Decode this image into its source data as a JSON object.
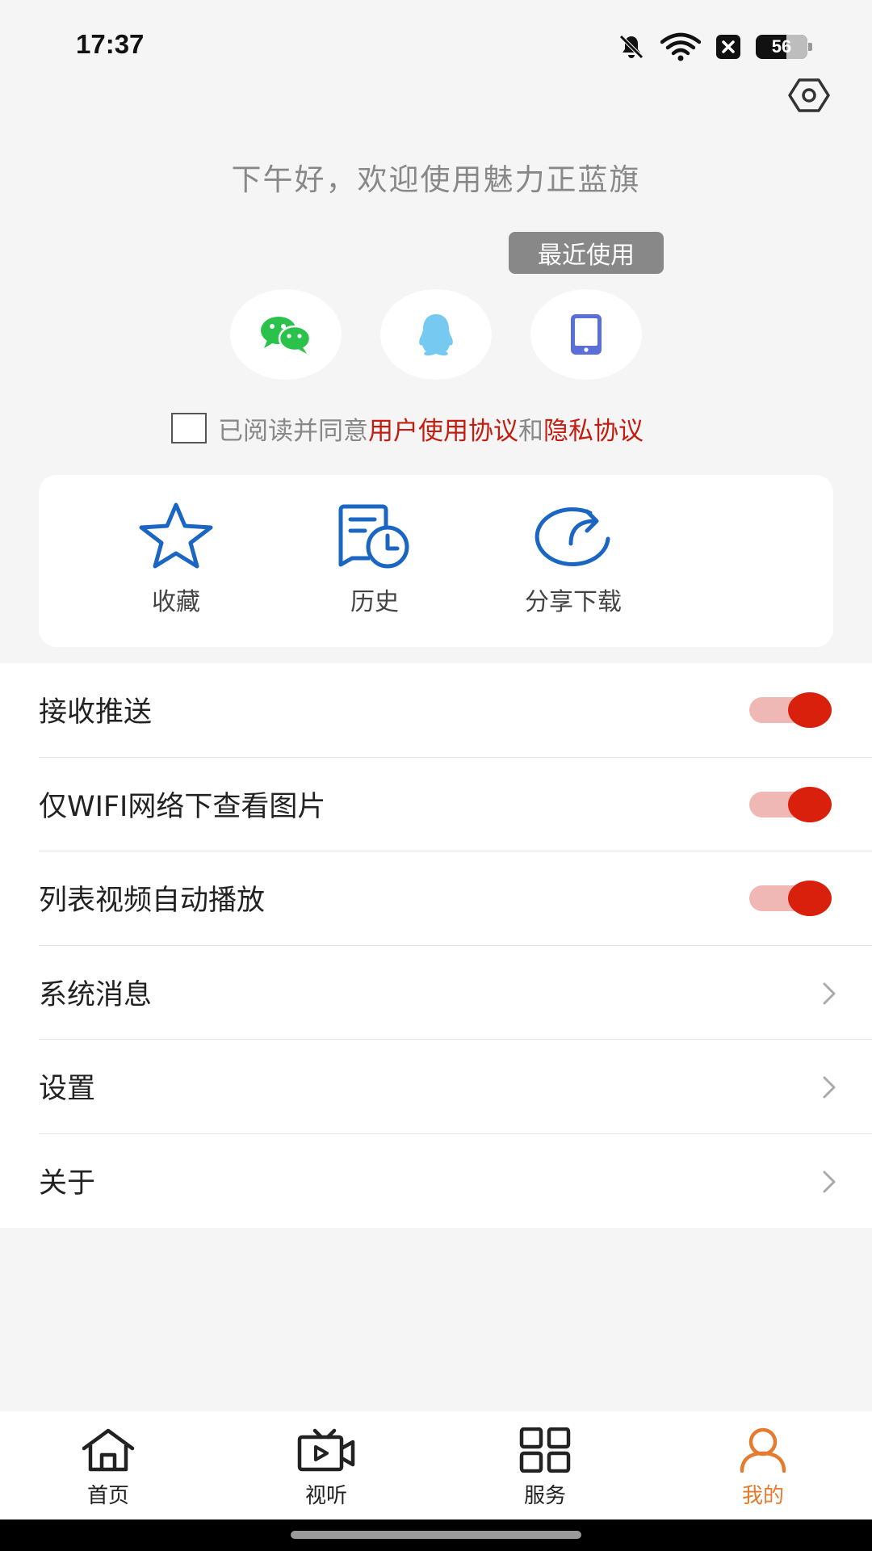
{
  "status_bar": {
    "time": "17:37",
    "battery": "56",
    "icons": [
      "mute-icon",
      "wifi-icon",
      "notification-x-icon",
      "battery-icon"
    ]
  },
  "header": {
    "scan_icon": "hexagon-scan-icon",
    "greeting": "下午好，欢迎使用魅力正蓝旗"
  },
  "login": {
    "recent_label": "最近使用",
    "methods": [
      {
        "name": "wechat",
        "icon": "wechat-icon",
        "color": "#2bc24c"
      },
      {
        "name": "qq",
        "icon": "qq-icon",
        "color": "#76c9f0"
      },
      {
        "name": "phone",
        "icon": "phone-icon",
        "color": "#5b6fd8"
      }
    ]
  },
  "agreement": {
    "checked": false,
    "prefix": "已阅读并同意",
    "user_agreement": "用户使用协议",
    "and": "和",
    "privacy": "隐私协议"
  },
  "quick_actions": [
    {
      "label": "收藏",
      "icon": "star-icon"
    },
    {
      "label": "历史",
      "icon": "history-icon"
    },
    {
      "label": "分享下载",
      "icon": "share-icon"
    }
  ],
  "settings": {
    "push": {
      "label": "接收推送",
      "enabled": true
    },
    "wifi_images": {
      "label": "仅WIFI网络下查看图片",
      "enabled": true
    },
    "autoplay": {
      "label": "列表视频自动播放",
      "enabled": true
    },
    "messages": {
      "label": "系统消息"
    },
    "preferences": {
      "label": "设置"
    },
    "about": {
      "label": "关于"
    }
  },
  "bottom_nav": {
    "home": {
      "label": "首页",
      "icon": "home-icon"
    },
    "media": {
      "label": "视听",
      "icon": "tv-icon"
    },
    "service": {
      "label": "服务",
      "icon": "grid-icon"
    },
    "mine": {
      "label": "我的",
      "icon": "user-icon",
      "active": true
    }
  },
  "colors": {
    "accent_red": "#c41d10",
    "toggle_on": "#d9200d",
    "icon_blue": "#1a66c2",
    "nav_active": "#e57b2e"
  }
}
